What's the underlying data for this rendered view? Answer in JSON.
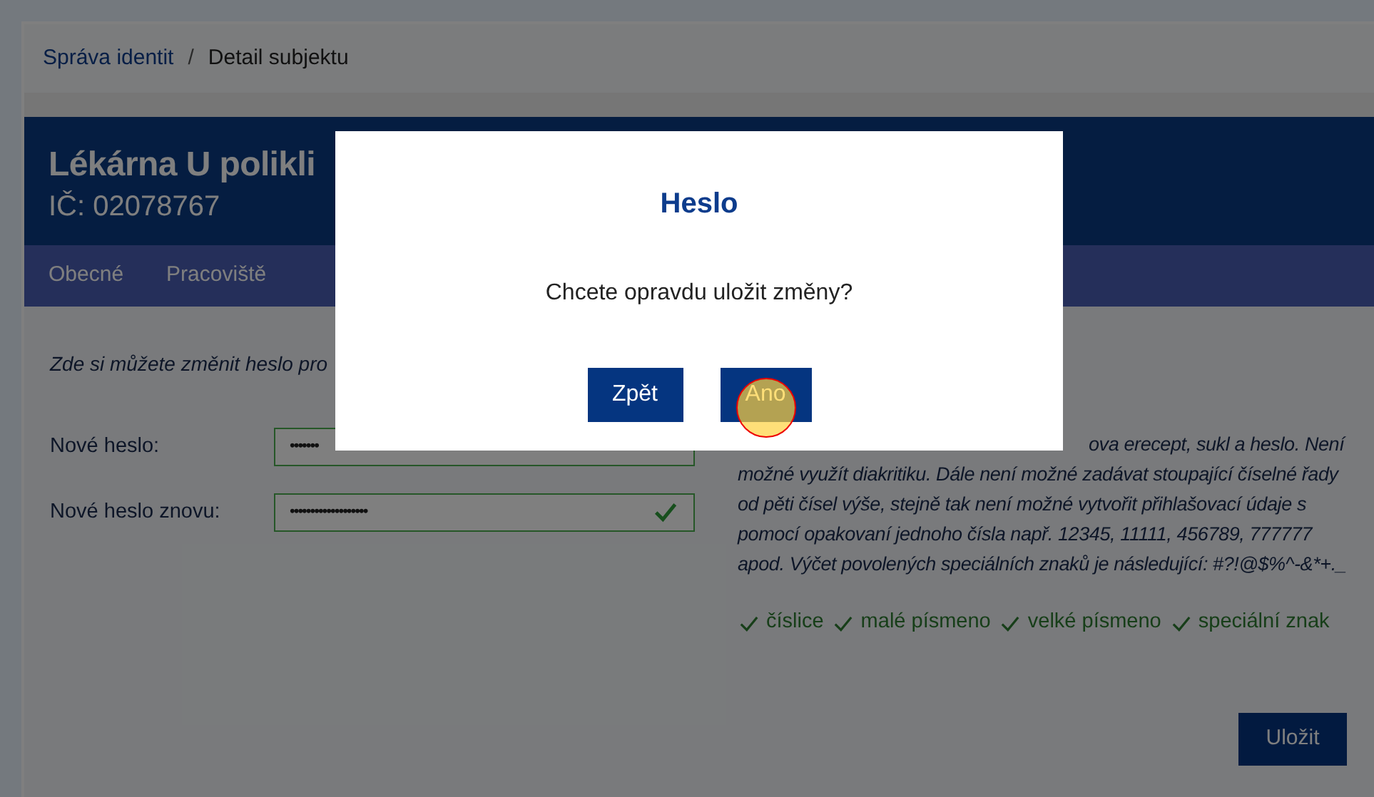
{
  "breadcrumb": {
    "items": [
      {
        "label": "Správa identit",
        "link": true
      },
      {
        "label": "Detail subjektu",
        "link": false
      }
    ],
    "separator": "/"
  },
  "subject": {
    "name": "Lékárna U polikli",
    "id": "IČ: 02078767"
  },
  "tabs": [
    {
      "label": "Obecné",
      "selected": false
    },
    {
      "label": "Pracoviště",
      "selected": false
    }
  ],
  "intro": "Zde si můžete změnit heslo pro",
  "fields": [
    {
      "label": "Nové heslo:",
      "value": "•••••••",
      "valid": true
    },
    {
      "label": "Nové heslo znovu:",
      "value": "•••••••••••••••••••",
      "valid": true
    }
  ],
  "help": "ova erecept, sukl a heslo. Není možné využít diakritiku. Dále není možné zadávat stoupající číselné řady od pěti čísel výše, stejně tak není možné vytvořit přihlašovací údaje s pomocí opakovaní jednoho čísla např. 12345, 11111, 456789, 777777 apod. Výčet povolených speciálních znaků je následující: #?!@$%^-&*+._",
  "rules": [
    {
      "label": "číslice",
      "met": true
    },
    {
      "label": "malé písmeno",
      "met": true
    },
    {
      "label": "velké písmeno",
      "met": true
    },
    {
      "label": "speciální znak",
      "met": true
    }
  ],
  "save_button": "Uložit",
  "dialog": {
    "title": "Heslo",
    "message": "Chcete opravdu uložit změny?",
    "buttons": [
      "Zpět",
      "Ano"
    ]
  }
}
